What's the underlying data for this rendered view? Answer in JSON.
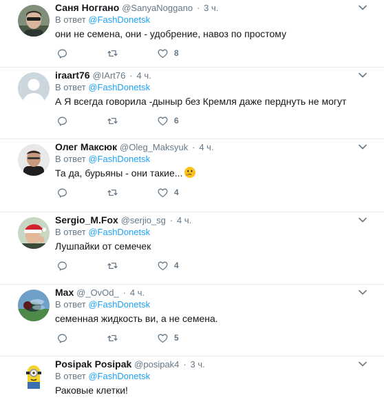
{
  "reply_prefix": "В ответ",
  "replies": [
    {
      "name": "Саня Ногrано",
      "handle": "@SanyaNoggano",
      "time": "3 ч.",
      "reply_to": "@FashDonetsk",
      "text": "они не семена, они - удобрение, навоз по простому",
      "likes": "8",
      "avatar_icon": "man-sunglasses-avatar"
    },
    {
      "name": "iraart76",
      "handle": "@IArt76",
      "time": "4 ч.",
      "reply_to": "@FashDonetsk",
      "text": "А Я всегда говорила -дыныр  без Кремля даже перднуть не могут",
      "likes": "6",
      "avatar_icon": "default-profile-avatar"
    },
    {
      "name": "Олег Максюк",
      "handle": "@Oleg_Maksyuk",
      "time": "4 ч.",
      "reply_to": "@FashDonetsk",
      "text": "Та да, бурьяны - они такие...",
      "likes": "4",
      "avatar_icon": "man-dark-avatar",
      "emoji": "thinking-face-emoji"
    },
    {
      "name": "Sergio_M.Fox",
      "handle": "@serjio_sg",
      "time": "4 ч.",
      "reply_to": "@FashDonetsk",
      "text": "Лушпайки от семечек",
      "likes": "4",
      "avatar_icon": "santa-hat-thumbs-up-avatar"
    },
    {
      "name": "Max",
      "handle": "@_OvOd_",
      "time": "4 ч.",
      "reply_to": "@FashDonetsk",
      "text": "семенная жидкость ви, а не семена.",
      "likes": "5",
      "avatar_icon": "fly-macro-avatar"
    },
    {
      "name": "Posipak Posipak",
      "handle": "@posipak4",
      "time": "3 ч.",
      "reply_to": "@FashDonetsk",
      "text": "Раковые клетки!",
      "likes": "",
      "avatar_icon": "minion-avatar"
    }
  ],
  "colors": {
    "link": "#1da1f2",
    "secondary": "#657786",
    "divider": "#e6ecf0",
    "text": "#14171a"
  }
}
